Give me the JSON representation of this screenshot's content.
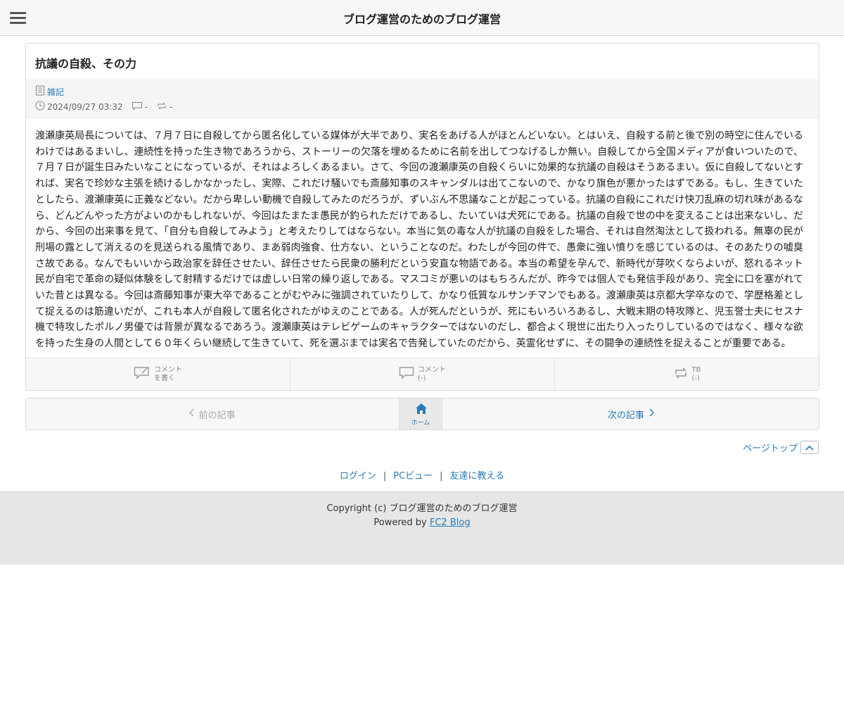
{
  "header": {
    "site_title": "ブログ運営のためのブログ運営"
  },
  "entry": {
    "title": "抗議の自殺、その力",
    "category": "雑記",
    "datetime": "2024/09/27 03:32",
    "comment_count": "-",
    "trackback_count": "-",
    "body": "渡瀬康英局長については、７月７日に自殺してから匿名化している媒体が大半であり、実名をあげる人がほとんどいない。とはいえ、自殺する前と後で別の時空に住んでいるわけではあるまいし、連続性を持った生き物であろうから、ストーリーの欠落を埋めるために名前を出してつなげるしか無い。自殺してから全国メディアが食いついたので、７月７日が誕生日みたいなことになっているが、それはよろしくあるまい。さて、今回の渡瀬康英の自殺くらいに効果的な抗議の自殺はそうあるまい。仮に自殺してないとすれば、実名で珍妙な主張を続けるしかなかったし、実際、これだけ騒いでも斎藤知事のスキャンダルは出てこないので、かなり旗色が悪かったはずである。もし、生きていたとしたら、渡瀬康英に正義などない。だから卑しい動機で自殺してみたのだろうが、ずいぶん不思議なことが起こっている。抗議の自殺にこれだけ快刀乱麻の切れ味があるなら、どんどんやった方がよいのかもしれないが、今回はたまたま愚民が釣られただけであるし、たいていは犬死にである。抗議の自殺で世の中を変えることは出来ないし、だから、今回の出来事を見て、「自分も自殺してみよう」と考えたりしてはならない。本当に気の毒な人が抗議の自殺をした場合、それは自然淘汰として扱われる。無辜の民が刑場の露として消えるのを見送られる風情であり、まあ弱肉強食、仕方ない、ということなのだ。わたしが今回の件で、愚衆に強い憤りを感じているのは、そのあたりの嘘臭さ故である。なんでもいいから政治家を辞任させたい、辞任させたら民衆の勝利だという安直な物語である。本当の希望を孕んで、新時代が芽吹くならよいが、怒れるネット民が自宅で革命の疑似体験をして射精するだけでは虚しい日常の繰り返しである。マスコミが悪いのはもちろんだが、昨今では個人でも発信手段があり、完全に口を塞がれていた昔とは異なる。今回は斎藤知事が東大卒であることがむやみに強調されていたりして、かなり低質なルサンチマンでもある。渡瀬康英は京都大学卒なので、学歴格差として捉えるのは筋違いだが、これも本人が自殺して匿名化されたがゆえのことである。人が死んだというが、死にもいろいろあるし、大戦末期の特攻隊と、児玉誉士夫にセスナ機で特攻したポルノ男優では背景が異なるであろう。渡瀬康英はテレビゲームのキャラクターではないのだし、都合よく現世に出たり入ったりしているのではなく、様々な欲を持った生身の人間として６０年くらい継続して生きていて、死を選ぶまでは実名で告発していたのだから、英霊化せずに、その闘争の連続性を捉えることが重要である。"
  },
  "entry_footer": {
    "write_comment_line1": "コメント",
    "write_comment_line2": "を書く",
    "comments_line1": "コメント",
    "comments_line2": "(-)",
    "tb_line1": "TB",
    "tb_line2": "(-)"
  },
  "pager": {
    "prev_label": "前の記事",
    "home_label": "ホーム",
    "next_label": "次の記事"
  },
  "pagetop_label": "ページトップ",
  "links": {
    "login": "ログイン",
    "pc_view": "PCビュー",
    "tell_friend": "友達に教える",
    "separator": "|"
  },
  "footer": {
    "copyright": "Copyright (c) ブログ運営のためのブログ運営",
    "powered_by": "Powered by",
    "fc2_blog": "FC2 Blog"
  },
  "colors": {
    "link": "#2a7ab8",
    "header_bg": "#f7f7f7",
    "footer_bg": "#e6e6e6"
  },
  "icons": [
    "menu-icon",
    "notebook-icon",
    "clock-icon",
    "comment-icon",
    "trackback-icon",
    "comment-write-icon",
    "chevron-left-icon",
    "home-icon",
    "chevron-right-icon",
    "chevron-up-icon"
  ]
}
